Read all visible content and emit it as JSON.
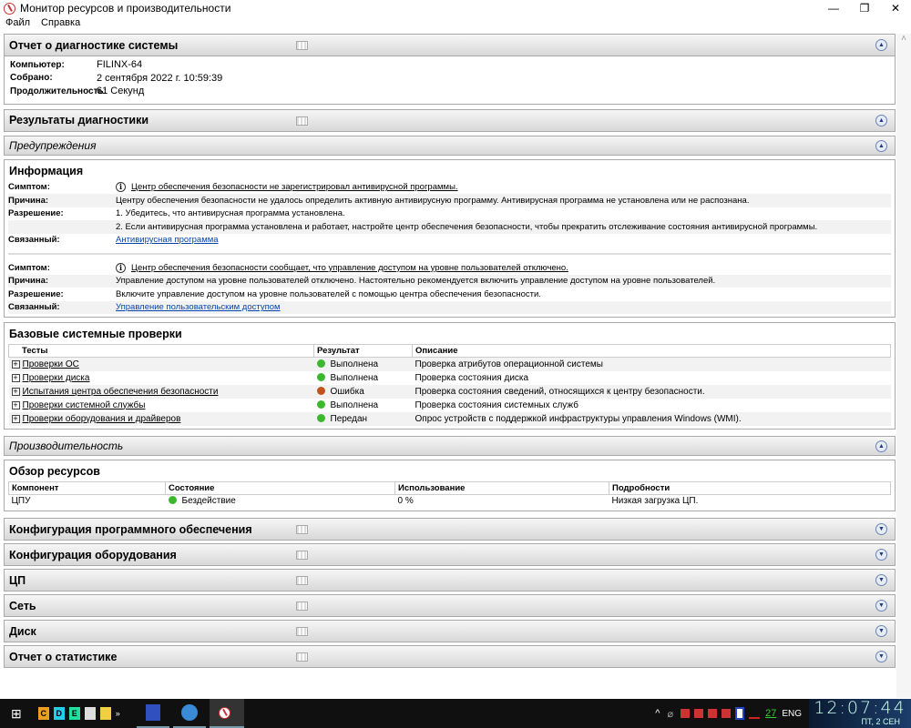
{
  "window": {
    "title": "Монитор ресурсов и производительности"
  },
  "menu": [
    "Файл",
    "Справка"
  ],
  "report": {
    "title": "Отчет о диагностике системы",
    "rows": [
      {
        "k": "Компьютер:",
        "v": "FILINX-64"
      },
      {
        "k": "Собрано:",
        "v": "2 сентября 2022 г. 10:59:39"
      },
      {
        "k": "Продолжительность:",
        "v": "61 Секунд"
      }
    ]
  },
  "diag_results": "Результаты диагностики",
  "warnings": "Предупреждения",
  "info": {
    "title": "Информация",
    "b1": {
      "symptom_k": "Симптом:",
      "symptom": "Центр обеспечения безопасности не зарегистрировал антивирусной программы.",
      "cause_k": "Причина:",
      "cause": "Центру обеспечения безопасности не удалось определить активную антивирусную программу. Антивирусная программа не установлена или не распознана.",
      "res_k": "Разрешение:",
      "res1": "1. Убедитесь, что антивирусная программа установлена.",
      "res2": "2. Если антивирусная программа установлена и работает, настройте центр обеспечения безопасности, чтобы прекратить отслеживание состояния антивирусной программы.",
      "rel_k": "Связанный:",
      "rel": "Антивирусная программа"
    },
    "b2": {
      "symptom_k": "Симптом:",
      "symptom": "Центр обеспечения безопасности сообщает, что управление доступом на уровне пользователей отключено.",
      "cause_k": "Причина:",
      "cause": "Управление доступом на уровне пользователей отключено. Настоятельно рекомендуется включить управление доступом на уровне пользователей.",
      "res_k": "Разрешение:",
      "res1": "Включите управление доступом на уровне пользователей с помощью центра обеспечения безопасности.",
      "rel_k": "Связанный:",
      "rel": "Управление пользовательским доступом"
    }
  },
  "checks": {
    "title": "Базовые системные проверки",
    "headers": [
      "Тесты",
      "Результат",
      "Описание"
    ],
    "rows": [
      {
        "test": "Проверки ОС",
        "result": "Выполнена",
        "desc": "Проверка атрибутов операционной системы"
      },
      {
        "test": "Проверки диска",
        "result": "Выполнена",
        "desc": "Проверка состояния диска"
      },
      {
        "test": "Испытания центра обеспечения безопасности",
        "result": "Ошибка",
        "desc": "Проверка состояния сведений, относящихся к центру безопасности."
      },
      {
        "test": "Проверки системной службы",
        "result": "Выполнена",
        "desc": "Проверка состояния системных служб"
      },
      {
        "test": "Проверки оборудования и драйверов",
        "result": "Передан",
        "desc": "Опрос устройств с поддержкой инфраструктуры управления Windows (WMI)."
      }
    ]
  },
  "perf": "Производительность",
  "resources": {
    "title": "Обзор ресурсов",
    "headers": [
      "Компонент",
      "Состояние",
      "Использование",
      "Подробности"
    ],
    "row": {
      "component": "ЦПУ",
      "state": "Бездействие",
      "usage": "0 %",
      "details": "Низкая загрузка ЦП."
    }
  },
  "collapsed": [
    "Конфигурация программного обеспечения",
    "Конфигурация оборудования",
    "ЦП",
    "Сеть",
    "Диск",
    "Отчет о статистике"
  ],
  "taskbar": {
    "drives": [
      "C",
      "D",
      "E"
    ],
    "temp": "27",
    "lang": "ENG",
    "time": "12:07:44",
    "date": "ПТ, 2 СЕН"
  },
  "colors": {
    "ok": "#3db82e",
    "error": "#c0541f"
  }
}
